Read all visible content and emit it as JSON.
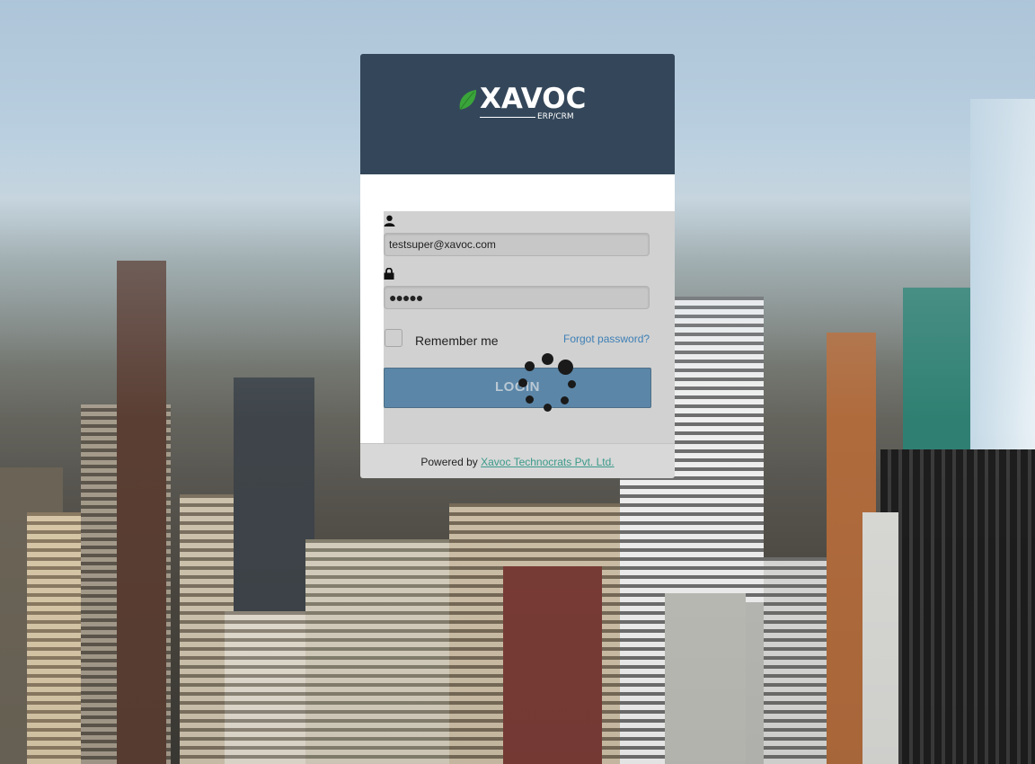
{
  "brand": {
    "logo_text": "XAVOC",
    "logo_subtext": "ERP/CRM",
    "leaf_color": "#3aa53a",
    "header_color": "#34475a"
  },
  "form": {
    "username_icon": "user-icon",
    "username_value": "testsuper@xavoc.com",
    "password_icon": "lock-icon",
    "password_value": "●●●●●",
    "remember_label": "Remember me",
    "remember_checked": false,
    "forgot_label": "Forgot password?",
    "login_label": "LOGIN",
    "login_color": "#5b86a8",
    "loading": true
  },
  "footer": {
    "powered_prefix": "Powered by",
    "company_link": "Xavoc Technocrats Pvt. Ltd.",
    "link_color": "#3b9a8a"
  }
}
